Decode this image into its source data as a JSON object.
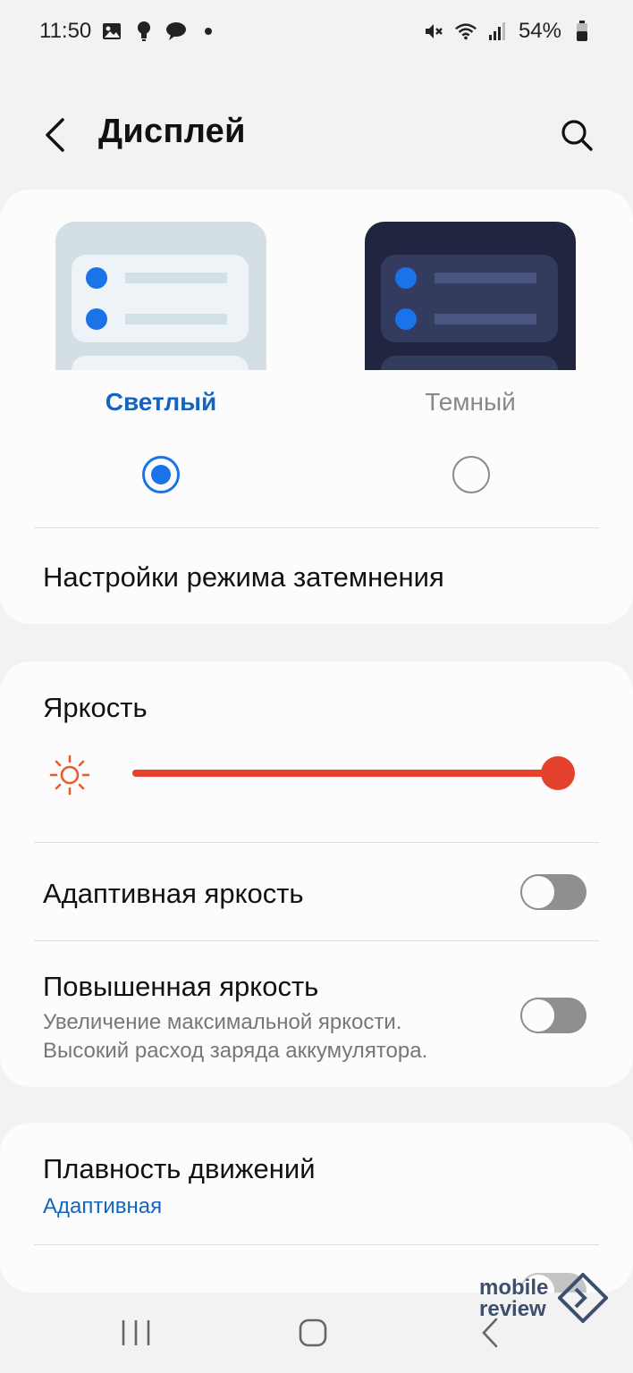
{
  "status_bar": {
    "time": "11:50",
    "battery": "54%",
    "icons": [
      "gallery-icon",
      "bulb-icon",
      "chat-icon",
      "dot-icon",
      "mute-icon",
      "wifi-icon",
      "signal-icon",
      "battery-icon"
    ]
  },
  "header": {
    "title": "Дисплей"
  },
  "theme": {
    "light_label": "Светлый",
    "dark_label": "Темный",
    "selected": "light",
    "dark_mode_settings": "Настройки режима затемнения"
  },
  "brightness": {
    "label": "Яркость",
    "level": 1.0
  },
  "adaptive_brightness": {
    "label": "Адаптивная яркость",
    "on": false
  },
  "extra_brightness": {
    "label": "Повышенная яркость",
    "subtitle_line1": "Увеличение максимальной яркости.",
    "subtitle_line2": "Высокий расход заряда аккумулятора.",
    "on": false
  },
  "motion_smoothness": {
    "label": "Плавность движений",
    "value": "Адаптивная"
  },
  "watermark": {
    "line1": "mobile",
    "line2": "review"
  },
  "colors": {
    "accent_blue": "#1a73e8",
    "slider_red": "#e5412f"
  }
}
